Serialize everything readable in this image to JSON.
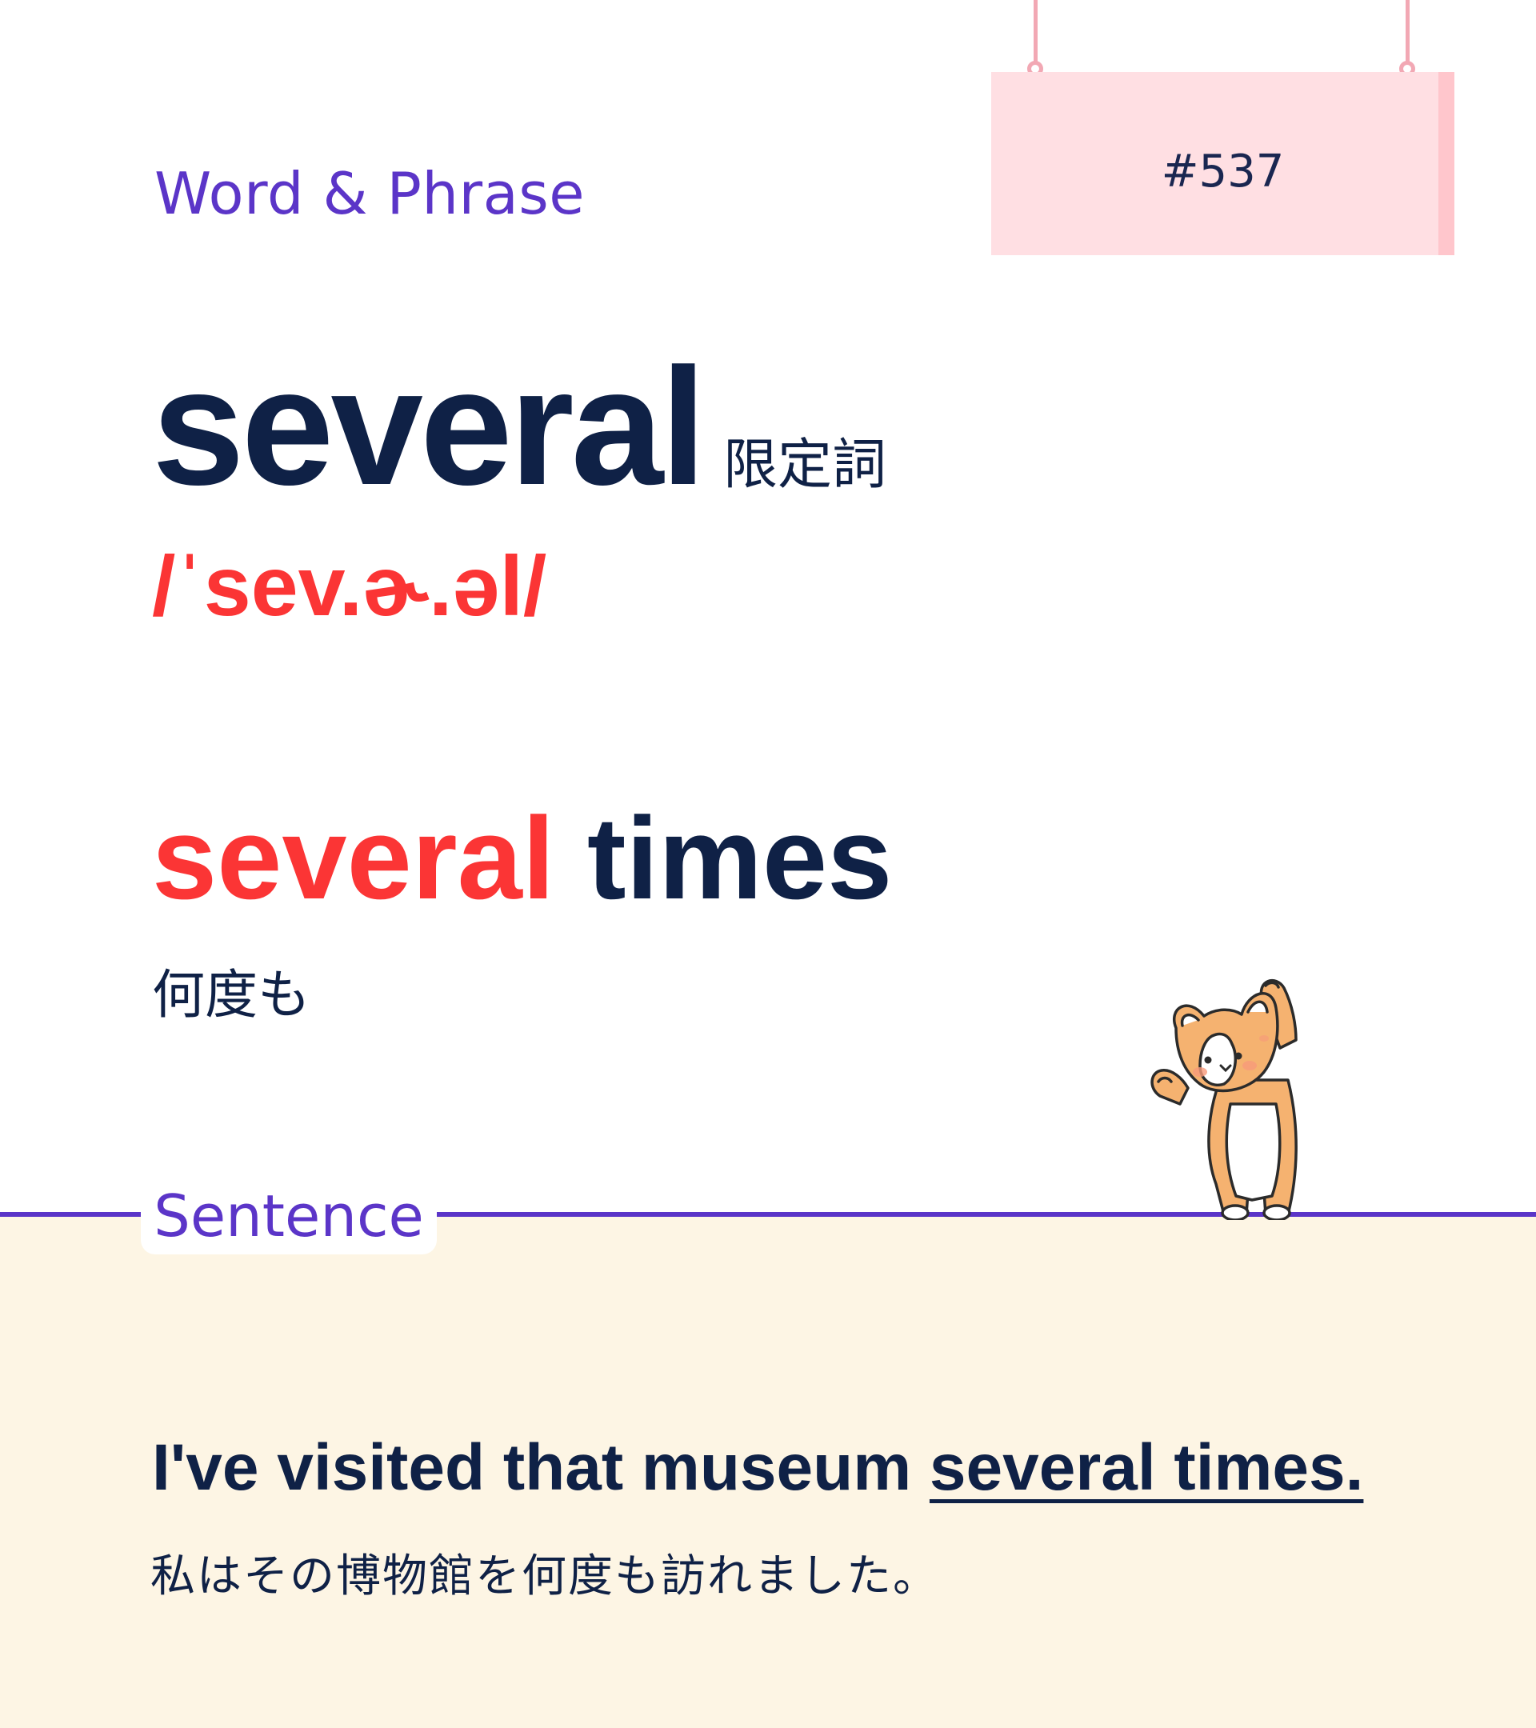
{
  "header": {
    "section_label": "Word & Phrase",
    "entry_number": "#537"
  },
  "word": {
    "headword": "several",
    "part_of_speech": "限定詞",
    "pronunciation": "/ˈsev.ɚ.əl/"
  },
  "phrase": {
    "highlight": "several",
    "rest": " times",
    "translation": "何度も"
  },
  "sentence_section": {
    "label": "Sentence",
    "sentence_prefix": "I've visited that museum ",
    "sentence_highlight": "several times.",
    "translation": "私はその博物館を何度も訪れました。"
  },
  "colors": {
    "accent_purple": "#5b35c8",
    "accent_red": "#fb3535",
    "text_navy": "#0f2146",
    "sign_pink": "#ffdfe3",
    "panel_cream": "#fdf5e4"
  },
  "icons": {
    "mascot": "corgi-mascot-icon"
  }
}
